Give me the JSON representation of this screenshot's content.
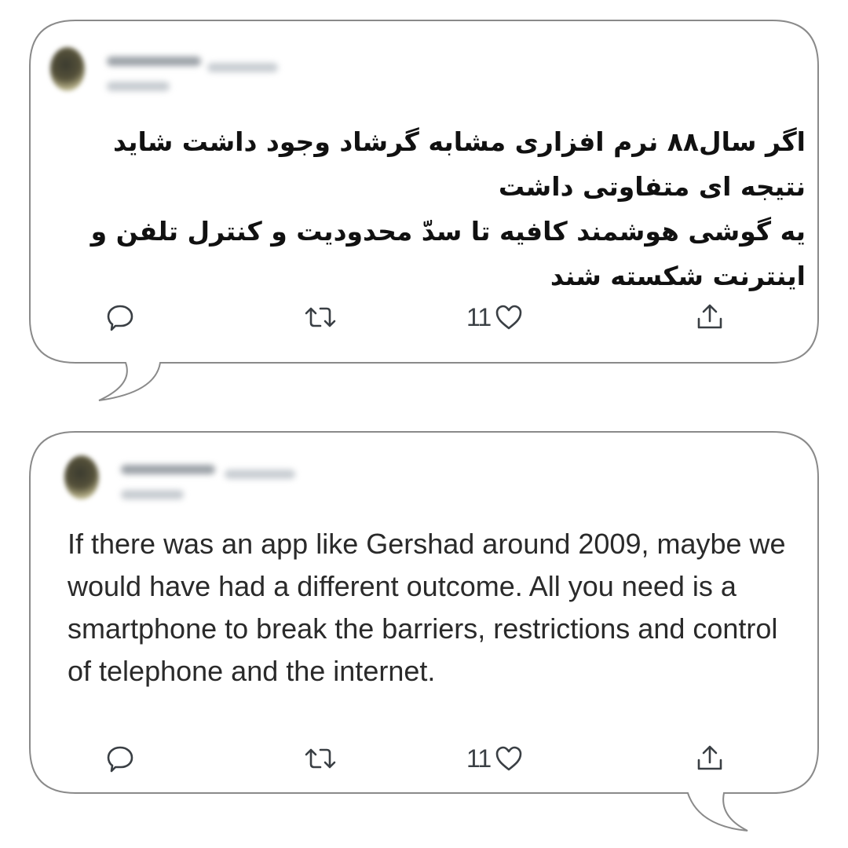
{
  "tweets": [
    {
      "text_lines": [
        "اگر سال۸۸ نرم افزاری مشابه گرشاد وجود داشت شاید نتیجه ای متفاوتی داشت",
        "یه گوشی هوشمند کافیه تا سدّ محدودیت و کنترل تلفن و اینترنت شکسته شند"
      ],
      "actions": {
        "like_count": "11"
      }
    },
    {
      "text": "If there was an app like Gershad around 2009, maybe we would have had a different outcome. All you need is a smartphone to break the barriers, restrictions and control of telephone and the internet.",
      "actions": {
        "like_count": "11"
      }
    }
  ],
  "icons": {
    "reply": "speech-bubble-icon",
    "retweet": "retweet-icon",
    "like": "heart-icon",
    "share": "share-upload-icon"
  },
  "colors": {
    "background": "#ffffff",
    "border": "#8a8a8a",
    "icon": "#3a3f44",
    "text": "#111111"
  }
}
